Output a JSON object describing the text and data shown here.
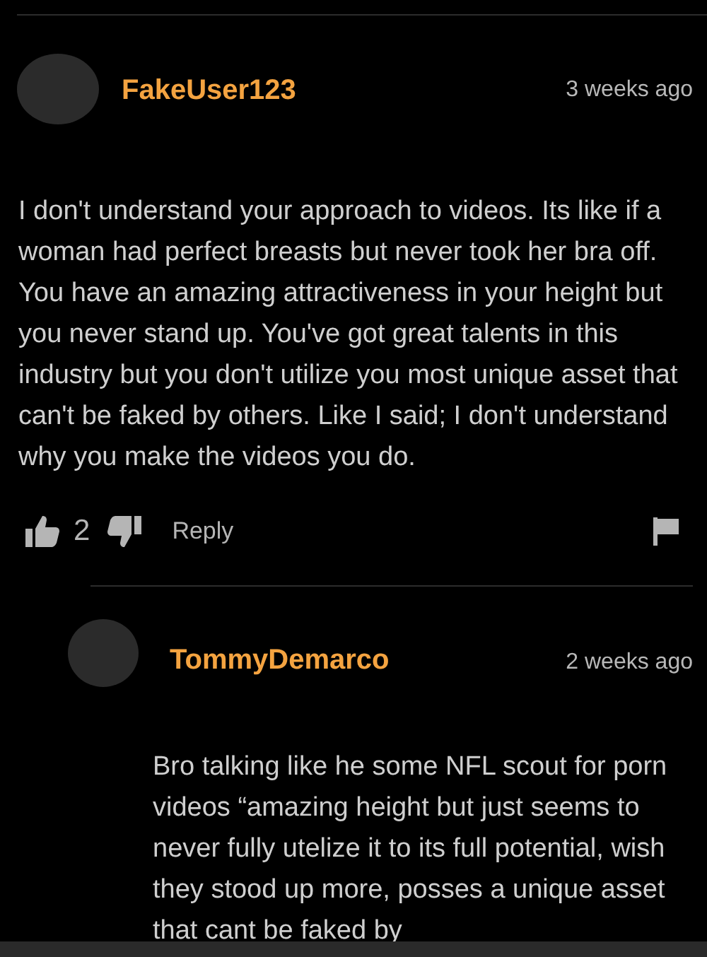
{
  "comments": [
    {
      "username": "FakeUser123",
      "time": "3 weeks ago",
      "body": "I don't understand your approach to videos. Its like if a woman had perfect breasts but never took her bra off. You have an amazing attractiveness in your height but you never stand up. You've got great talents in this industry but you don't utilize you most unique asset that can't be faked by others. Like I said; I don't understand why you make the videos you do.",
      "likes": "2",
      "reply_label": "Reply",
      "kind": "top"
    },
    {
      "username": "TommyDemarco",
      "time": "2 weeks ago",
      "body": "Bro talking like he some NFL scout for porn videos “amazing height but just seems to never fully utelize it to its full potential, wish they stood up more, posses a unique asset that cant be faked by",
      "kind": "reply"
    }
  ]
}
